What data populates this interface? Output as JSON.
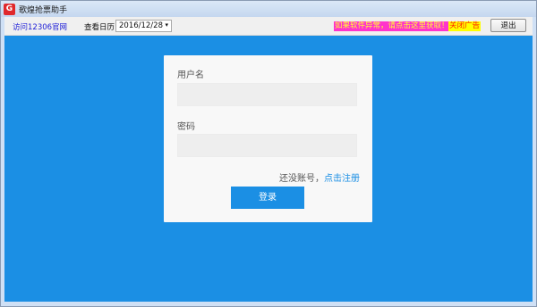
{
  "window": {
    "title": "歌煌抢票助手",
    "icon_letter": "G"
  },
  "toolbar": {
    "site_link": "访问12306官网",
    "calendar_label": "查看日历",
    "date_value": "2016/12/28",
    "date_arrow": "▾",
    "warning": "如果软件异常，请点击这里获取！",
    "close_ad": "关闭广告",
    "exit": "退出"
  },
  "login": {
    "username_label": "用户名",
    "username_value": "",
    "password_label": "密码",
    "password_value": "",
    "no_account_text": "还没账号，",
    "register_link": "点击注册",
    "login_button": "登录"
  },
  "colors": {
    "main_background": "#1b8fe4",
    "card_background": "#f8f8f8",
    "accent": "#1b8fe4",
    "warning_background": "#ff33cc",
    "warning_text": "#ffff33",
    "close_ad_background": "#ffff00",
    "close_ad_text": "#ff2200",
    "link": "#1b1bd6"
  }
}
